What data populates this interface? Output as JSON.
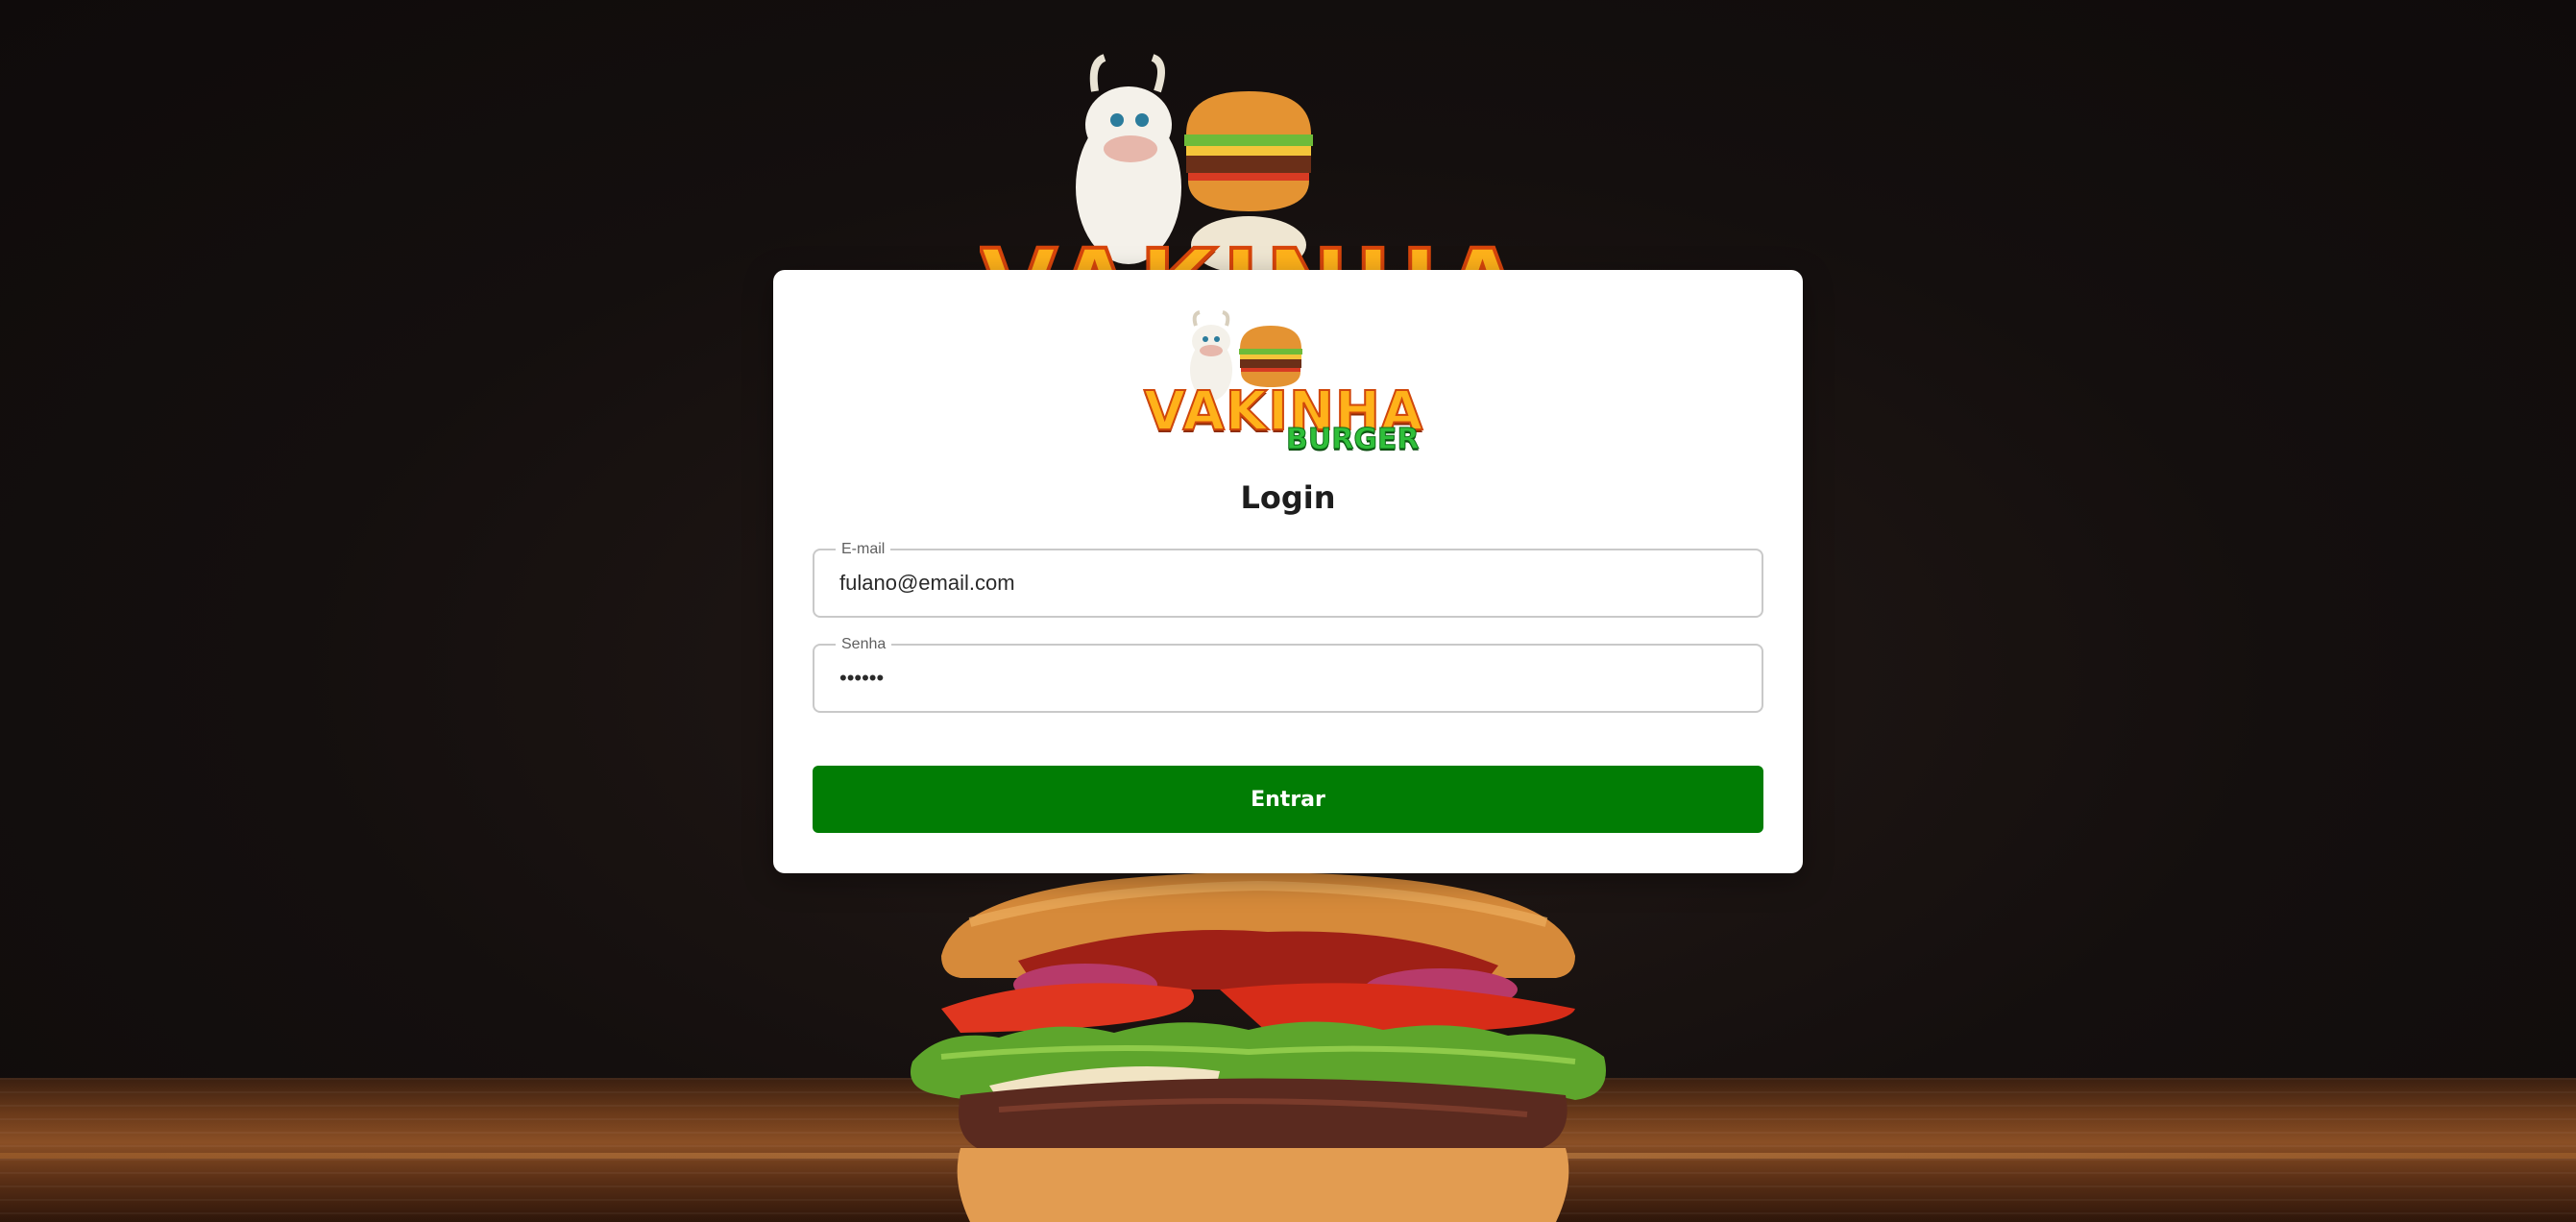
{
  "brand": {
    "name": "VAKINHA",
    "sub": "BURGER"
  },
  "login": {
    "title": "Login",
    "email": {
      "label": "E-mail",
      "value": "fulano@email.com"
    },
    "password": {
      "label": "Senha",
      "value": "••••••"
    },
    "submit_label": "Entrar"
  },
  "colors": {
    "primary_button": "#017d04",
    "brand_orange": "#ffb21a",
    "brand_green": "#2fbf3a",
    "background": "#140f0e"
  },
  "icons": {
    "mascot": "cow-mascot-icon",
    "burger": "burger-icon"
  }
}
